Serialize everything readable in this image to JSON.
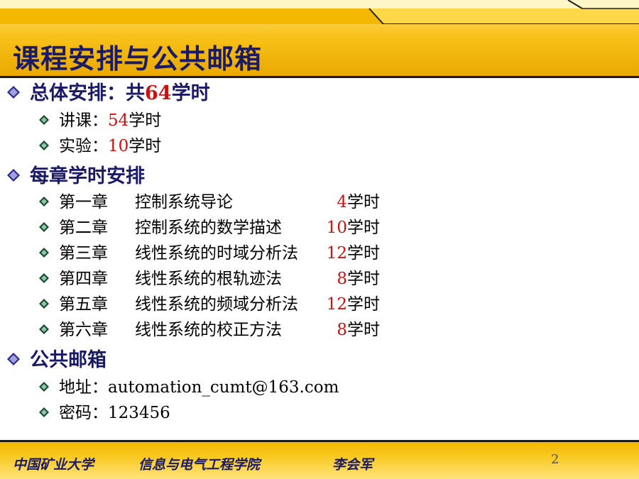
{
  "slide": {
    "title": "课程安排与公共邮箱",
    "page_number": "2"
  },
  "sections": {
    "total": {
      "label_prefix": "总体安排：共",
      "hours": "64",
      "label_suffix": "学时",
      "items": [
        {
          "label": "讲课：",
          "hours": "54",
          "unit": "学时"
        },
        {
          "label": "实验：",
          "hours": "10",
          "unit": "学时"
        }
      ]
    },
    "chapters": {
      "label": "每章学时安排",
      "items": [
        {
          "chapter": "第一章",
          "title": "控制系统导论",
          "hours": "4",
          "unit": "学时"
        },
        {
          "chapter": "第二章",
          "title": "控制系统的数学描述",
          "hours": "10",
          "unit": "学时"
        },
        {
          "chapter": "第三章",
          "title": "线性系统的时域分析法",
          "hours": "12",
          "unit": "学时"
        },
        {
          "chapter": "第四章",
          "title": "线性系统的根轨迹法",
          "hours": "8",
          "unit": "学时"
        },
        {
          "chapter": "第五章",
          "title": "线性系统的频域分析法",
          "hours": "12",
          "unit": "学时"
        },
        {
          "chapter": "第六章",
          "title": "线性系统的校正方法",
          "hours": "8",
          "unit": "学时"
        }
      ]
    },
    "mailbox": {
      "label": "公共邮箱",
      "address_label": "地址：",
      "address": "automation_cumt@163.com",
      "password_label": "密码：",
      "password": "123456"
    }
  },
  "footer": {
    "university": "中国矿业大学",
    "college": "信息与电气工程学院",
    "author": "李会军"
  },
  "colors": {
    "title": "#1a1a66",
    "highlight": "#d01010",
    "header_gold": "#f8c21a"
  }
}
